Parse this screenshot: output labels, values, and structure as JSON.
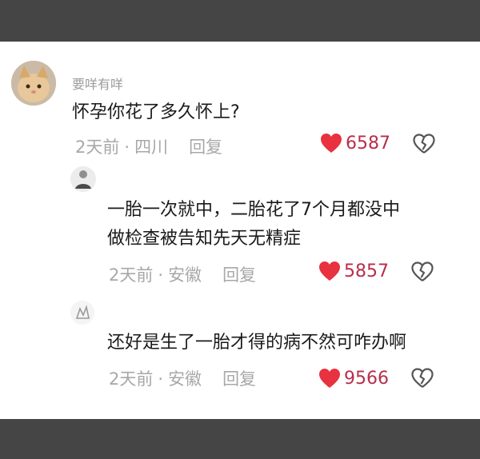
{
  "comments": [
    {
      "username": "要咩有咩",
      "text": "怀孕你花了多久怀上?",
      "time": "2天前",
      "location": "四川",
      "reply_label": "回复",
      "likes": "6587"
    },
    {
      "username": "",
      "text_line1": "一胎一次就中，二胎花了7个月都没中",
      "text_line2": "做检查被告知先天无精症",
      "time": "2天前",
      "location": "安徽",
      "reply_label": "回复",
      "likes": "5857"
    },
    {
      "username": "",
      "text": "还好是生了一胎才得的病不然可咋办啊",
      "time": "2天前",
      "location": "安徽",
      "reply_label": "回复",
      "likes": "9566"
    }
  ],
  "colors": {
    "like_heart": "#e8323f",
    "like_count": "#b72f4a",
    "meta_text": "#a8a8a8",
    "frame": "#454545"
  },
  "icons": [
    "heart-filled-icon",
    "broken-heart-icon"
  ]
}
